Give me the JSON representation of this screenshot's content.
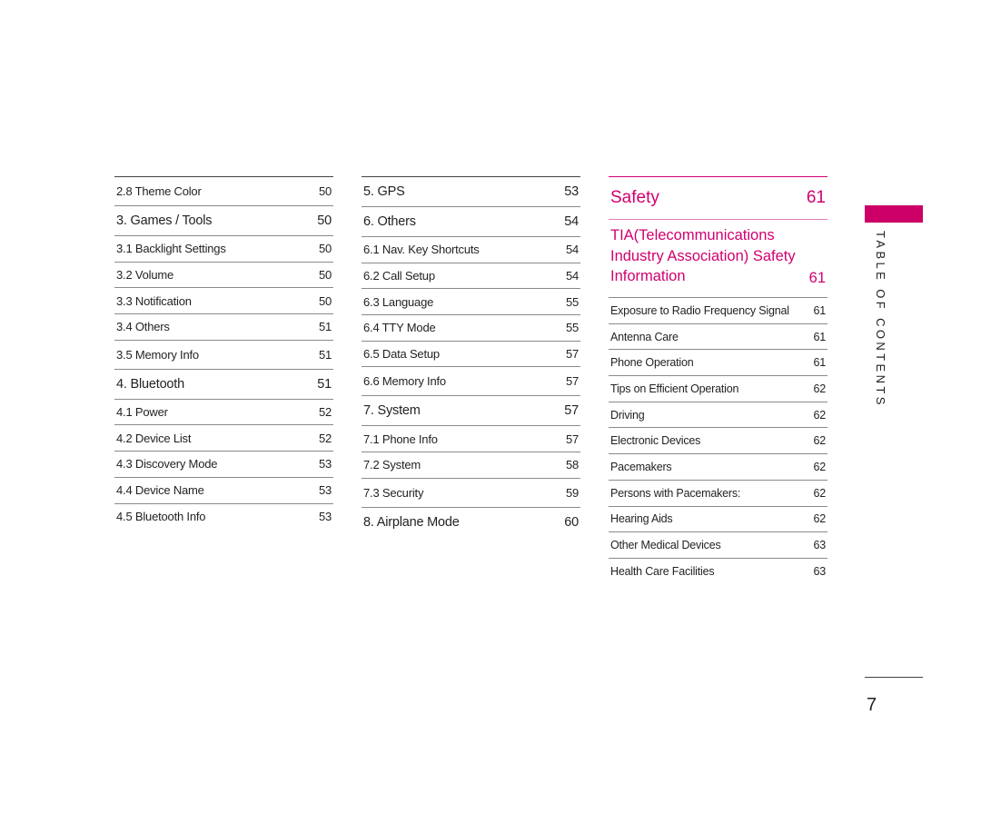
{
  "columns": [
    {
      "rows": [
        {
          "title": "2.8 Theme Color",
          "page": "50",
          "level": "sub"
        },
        {
          "title": "3. Games / Tools",
          "page": "50",
          "level": "main"
        },
        {
          "title": "3.1 Backlight Settings",
          "page": "50",
          "level": "sub"
        },
        {
          "title": "3.2 Volume",
          "page": "50",
          "level": "sub"
        },
        {
          "title": "3.3 Notification",
          "page": "50",
          "level": "sub"
        },
        {
          "title": "3.4 Others",
          "page": "51",
          "level": "sub"
        },
        {
          "title": "3.5 Memory Info",
          "page": "51",
          "level": "sub"
        },
        {
          "title": "4. Bluetooth",
          "page": "51",
          "level": "main"
        },
        {
          "title": "4.1 Power",
          "page": "52",
          "level": "sub"
        },
        {
          "title": "4.2 Device List",
          "page": "52",
          "level": "sub"
        },
        {
          "title": "4.3 Discovery Mode",
          "page": "53",
          "level": "sub"
        },
        {
          "title": "4.4 Device Name",
          "page": "53",
          "level": "sub"
        },
        {
          "title": "4.5 Bluetooth Info",
          "page": "53",
          "level": "sub"
        }
      ]
    },
    {
      "rows": [
        {
          "title": "5. GPS",
          "page": "53",
          "level": "main"
        },
        {
          "title": "6. Others",
          "page": "54",
          "level": "main"
        },
        {
          "title": "6.1 Nav. Key Shortcuts",
          "page": "54",
          "level": "sub"
        },
        {
          "title": "6.2 Call Setup",
          "page": "54",
          "level": "sub"
        },
        {
          "title": "6.3 Language",
          "page": "55",
          "level": "sub"
        },
        {
          "title": "6.4 TTY Mode",
          "page": "55",
          "level": "sub"
        },
        {
          "title": "6.5 Data Setup",
          "page": "57",
          "level": "sub"
        },
        {
          "title": "6.6 Memory Info",
          "page": "57",
          "level": "sub"
        },
        {
          "title": "7. System",
          "page": "57",
          "level": "main"
        },
        {
          "title": "7.1 Phone Info",
          "page": "57",
          "level": "sub"
        },
        {
          "title": "7.2 System",
          "page": "58",
          "level": "sub"
        },
        {
          "title": "7.3 Security",
          "page": "59",
          "level": "sub"
        },
        {
          "title": "8. Airplane Mode",
          "page": "60",
          "level": "main"
        }
      ]
    }
  ],
  "safety": {
    "heading": {
      "title": "Safety",
      "page": "61"
    },
    "tia": {
      "title": "TIA(Telecommunications Industry Association) Safety Information",
      "page": "61"
    },
    "rows": [
      {
        "title": "Exposure to Radio Frequency Signal",
        "page": "61"
      },
      {
        "title": "Antenna Care",
        "page": "61"
      },
      {
        "title": "Phone Operation",
        "page": "61"
      },
      {
        "title": "Tips on Efficient Operation",
        "page": "62"
      },
      {
        "title": "Driving",
        "page": "62"
      },
      {
        "title": "Electronic Devices",
        "page": "62"
      },
      {
        "title": "Pacemakers",
        "page": "62"
      },
      {
        "title": "Persons with Pacemakers:",
        "page": "62"
      },
      {
        "title": "Hearing Aids",
        "page": "62"
      },
      {
        "title": "Other Medical Devices",
        "page": "63"
      },
      {
        "title": "Health Care Facilities",
        "page": "63"
      }
    ]
  },
  "side_label": "TABLE OF CONTENTS",
  "page_number": "7",
  "colors": {
    "accent": "#cc0066",
    "text": "#231f20",
    "rule": "#8a8a8a"
  }
}
